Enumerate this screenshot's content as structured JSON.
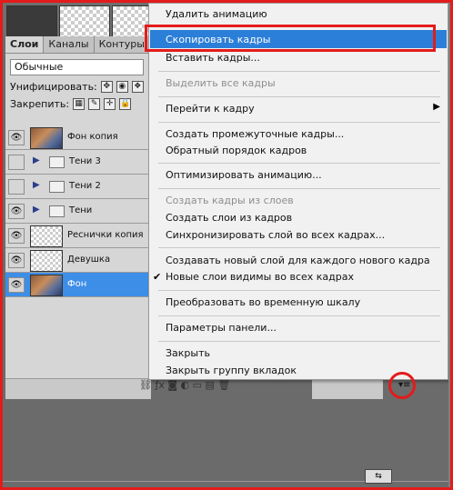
{
  "panel": {
    "tabs": [
      "Слои",
      "Каналы",
      "Контуры"
    ],
    "blend_mode": "Обычные",
    "unify_label": "Унифицировать:",
    "lock_label": "Закрепить:"
  },
  "layers": [
    {
      "name": "Фон копия",
      "type": "layer",
      "visible": true,
      "thumb": "photo",
      "selected": false
    },
    {
      "name": "Тени 3",
      "type": "group",
      "visible": false,
      "selected": false
    },
    {
      "name": "Тени 2",
      "type": "group",
      "visible": false,
      "selected": false
    },
    {
      "name": "Тени",
      "type": "group",
      "visible": true,
      "selected": false
    },
    {
      "name": "Реснички копия",
      "type": "layer",
      "visible": true,
      "thumb": "checker",
      "selected": false
    },
    {
      "name": "Девушка",
      "type": "layer",
      "visible": true,
      "thumb": "checker",
      "selected": false
    },
    {
      "name": "Фон",
      "type": "layer",
      "visible": true,
      "thumb": "photo",
      "selected": true
    }
  ],
  "menu": {
    "items": [
      {
        "label": "Удалить анимацию",
        "enabled": true
      },
      {
        "label": "Скопировать кадры",
        "enabled": true,
        "highlighted": true
      },
      {
        "label": "Вставить кадры...",
        "enabled": true
      },
      {
        "label": "Выделить все кадры",
        "enabled": false
      },
      {
        "label": "Перейти к кадру",
        "enabled": true,
        "submenu": true
      },
      {
        "label": "Создать промежуточные кадры...",
        "enabled": true
      },
      {
        "label": "Обратный порядок кадров",
        "enabled": true
      },
      {
        "label": "Оптимизировать анимацию...",
        "enabled": true
      },
      {
        "label": "Создать кадры из слоев",
        "enabled": false
      },
      {
        "label": "Создать слои из кадров",
        "enabled": true
      },
      {
        "label": "Синхронизировать слой во всех кадрах...",
        "enabled": true
      },
      {
        "label": "Создавать новый слой для каждого нового кадра",
        "enabled": true
      },
      {
        "label": "Новые слои видимы во всех кадрах",
        "enabled": true,
        "checked": true
      },
      {
        "label": "Преобразовать во временную шкалу",
        "enabled": true
      },
      {
        "label": "Параметры панели...",
        "enabled": true
      },
      {
        "label": "Закрыть",
        "enabled": true
      },
      {
        "label": "Закрыть группу вкладок",
        "enabled": true
      }
    ]
  },
  "colors": {
    "accent": "#2c7fd8",
    "outline": "#e41b1b",
    "panel": "#d6d6d6",
    "selected_layer": "#3d8ee6"
  },
  "icons": {
    "eye": "eye-icon",
    "folder": "folder-icon",
    "arrow": "disclosure-arrow-icon",
    "panel_menu": "panel-menu-icon"
  }
}
